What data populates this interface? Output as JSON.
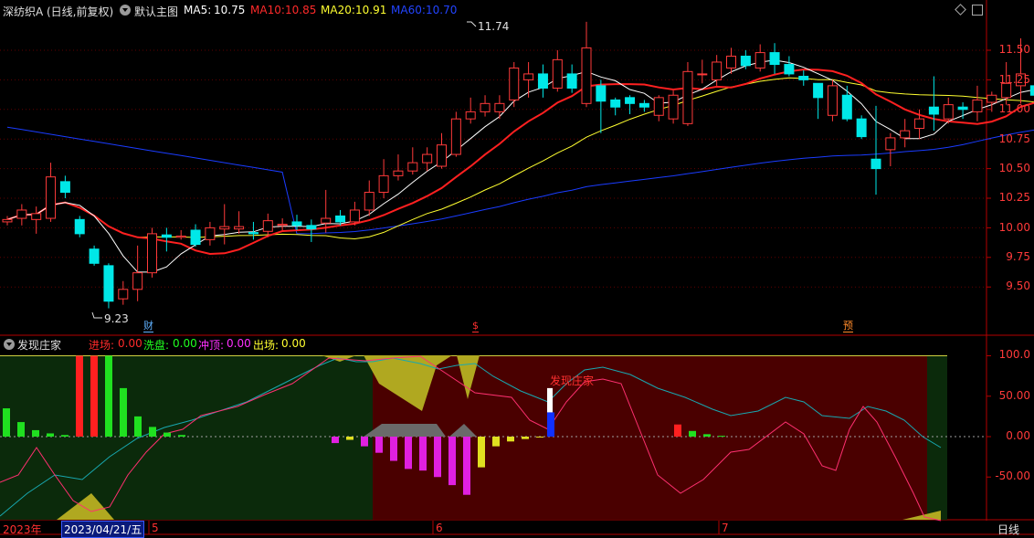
{
  "header": {
    "stock_name": "深纺织A",
    "period": "(日线,前复权)",
    "template": "默认主图",
    "ma5_label": "MA5:",
    "ma5_value": "10.75",
    "ma10_label": "MA10:",
    "ma10_value": "10.85",
    "ma20_label": "MA20:",
    "ma20_value": "10.91",
    "ma60_label": "MA60:",
    "ma60_value": "10.70",
    "colors": {
      "ma5": "#ffffff",
      "ma10": "#ff2020",
      "ma20": "#ffff30",
      "ma60": "#1a3cff"
    }
  },
  "price_axis": [
    "11.50",
    "11.25",
    "11.00",
    "10.75",
    "10.50",
    "10.25",
    "10.00",
    "9.75",
    "9.50"
  ],
  "annotations": {
    "high": "11.74",
    "low": "9.23"
  },
  "event_markers": [
    {
      "label": "财",
      "color": "#5fb0ff"
    },
    {
      "label": "$",
      "color": "#ff3030"
    },
    {
      "label": "预",
      "color": "#ff8a2a"
    }
  ],
  "indicator": {
    "title": "发现庄家",
    "jinchang_label": "进场:",
    "jinchang_value": "0.00",
    "xipan_label": "洗盘:",
    "xipan_value": "0.00",
    "chongding_label": "冲顶:",
    "chongding_value": "0.00",
    "chuchang_label": "出场:",
    "chuchang_value": "0.00",
    "signal_label": "发现庄家",
    "axis": [
      "100.0",
      "50.00",
      "0.00",
      "-50.00"
    ]
  },
  "time_axis": {
    "year_label": "2023年",
    "cursor_date": "2023/04/21/五",
    "months": [
      "5",
      "6",
      "7"
    ]
  },
  "period_button": "日线",
  "chart_data": {
    "type": "candlestick",
    "title": "深纺织A (日线,前复权)",
    "ylim": [
      9.1,
      11.9
    ],
    "price_ticks": [
      9.5,
      9.75,
      10.0,
      10.25,
      10.5,
      10.75,
      11.0,
      11.25,
      11.5
    ],
    "high_marker": 11.74,
    "low_marker": 9.23,
    "moving_averages": {
      "MA5": 10.75,
      "MA10": 10.85,
      "MA20": 10.91,
      "MA60": 10.7
    },
    "candles": [
      [
        10.05,
        10.07,
        10.02,
        10.1
      ],
      [
        10.08,
        10.15,
        10.02,
        10.2
      ],
      [
        10.07,
        10.12,
        9.95,
        10.18
      ],
      [
        10.08,
        10.43,
        10.05,
        10.55
      ],
      [
        10.39,
        10.3,
        10.25,
        10.44
      ],
      [
        10.07,
        9.95,
        9.92,
        10.1
      ],
      [
        9.82,
        9.7,
        9.68,
        9.85
      ],
      [
        9.68,
        9.38,
        9.32,
        9.7
      ],
      [
        9.4,
        9.48,
        9.35,
        9.55
      ],
      [
        9.48,
        9.62,
        9.38,
        9.85
      ],
      [
        9.62,
        9.95,
        9.58,
        10.0
      ],
      [
        9.94,
        9.92,
        9.8,
        10.0
      ],
      [
        9.92,
        9.93,
        9.9,
        9.98
      ],
      [
        9.98,
        9.86,
        9.84,
        10.03
      ],
      [
        9.9,
        10.0,
        9.85,
        10.05
      ],
      [
        9.99,
        10.01,
        9.86,
        10.2
      ],
      [
        9.99,
        10.01,
        9.95,
        10.14
      ],
      [
        9.96,
        9.95,
        9.9,
        10.05
      ],
      [
        9.97,
        10.06,
        9.92,
        10.12
      ],
      [
        10.02,
        10.03,
        9.98,
        10.08
      ],
      [
        10.05,
        10.02,
        9.98,
        10.11
      ],
      [
        10.02,
        9.99,
        9.88,
        10.07
      ],
      [
        10.04,
        10.08,
        9.96,
        10.32
      ],
      [
        10.1,
        10.05,
        10.02,
        10.15
      ],
      [
        10.05,
        10.15,
        10.02,
        10.22
      ],
      [
        10.15,
        10.3,
        10.1,
        10.4
      ],
      [
        10.3,
        10.44,
        10.25,
        10.58
      ],
      [
        10.44,
        10.48,
        10.4,
        10.62
      ],
      [
        10.48,
        10.55,
        10.45,
        10.68
      ],
      [
        10.55,
        10.62,
        10.48,
        10.68
      ],
      [
        10.52,
        10.7,
        10.5,
        10.8
      ],
      [
        10.62,
        10.92,
        10.6,
        10.98
      ],
      [
        10.92,
        10.98,
        10.88,
        11.1
      ],
      [
        10.98,
        11.05,
        10.94,
        11.12
      ],
      [
        10.98,
        11.05,
        10.92,
        11.12
      ],
      [
        11.08,
        11.35,
        11.02,
        11.4
      ],
      [
        11.25,
        11.3,
        11.1,
        11.4
      ],
      [
        11.3,
        11.18,
        11.1,
        11.38
      ],
      [
        11.18,
        11.42,
        11.15,
        11.5
      ],
      [
        11.3,
        11.18,
        11.14,
        11.38
      ],
      [
        11.05,
        11.52,
        11.02,
        11.74
      ],
      [
        11.2,
        11.07,
        10.8,
        11.25
      ],
      [
        11.08,
        11.02,
        10.95,
        11.1
      ],
      [
        11.1,
        11.05,
        10.96,
        11.12
      ],
      [
        11.05,
        11.02,
        10.98,
        11.08
      ],
      [
        10.95,
        11.1,
        10.9,
        11.12
      ],
      [
        10.92,
        11.12,
        10.88,
        11.16
      ],
      [
        10.88,
        11.32,
        10.86,
        11.4
      ],
      [
        11.3,
        11.3,
        11.22,
        11.42
      ],
      [
        11.25,
        11.4,
        11.2,
        11.46
      ],
      [
        11.35,
        11.45,
        11.3,
        11.52
      ],
      [
        11.45,
        11.37,
        11.34,
        11.5
      ],
      [
        11.35,
        11.48,
        11.32,
        11.55
      ],
      [
        11.48,
        11.38,
        11.3,
        11.56
      ],
      [
        11.38,
        11.3,
        11.28,
        11.45
      ],
      [
        11.28,
        11.25,
        11.2,
        11.33
      ],
      [
        11.22,
        11.1,
        10.92,
        11.22
      ],
      [
        10.95,
        11.2,
        10.9,
        11.25
      ],
      [
        11.12,
        10.92,
        10.9,
        11.2
      ],
      [
        10.92,
        10.77,
        10.75,
        10.95
      ],
      [
        10.58,
        10.5,
        10.28,
        11.03
      ],
      [
        10.66,
        10.76,
        10.52,
        10.8
      ],
      [
        10.76,
        10.82,
        10.68,
        10.92
      ],
      [
        10.84,
        10.92,
        10.75,
        11.0
      ],
      [
        11.02,
        10.96,
        10.82,
        11.28
      ],
      [
        10.92,
        11.04,
        10.88,
        11.1
      ],
      [
        11.02,
        11.0,
        10.92,
        11.06
      ],
      [
        10.98,
        11.08,
        10.9,
        11.2
      ],
      [
        11.06,
        11.12,
        10.98,
        11.15
      ],
      [
        11.1,
        11.22,
        11.04,
        11.4
      ],
      [
        11.2,
        11.3,
        11.05,
        11.6
      ],
      [
        11.2,
        11.12,
        10.98,
        11.36
      ],
      [
        11.12,
        11.02,
        10.92,
        11.14
      ],
      [
        11.1,
        10.7,
        10.66,
        11.15
      ],
      [
        10.7,
        11.0,
        10.68,
        11.04
      ],
      [
        10.95,
        10.98,
        10.9,
        11.06
      ],
      [
        11.0,
        11.22,
        10.96,
        11.25
      ],
      [
        11.15,
        11.28,
        11.1,
        11.32
      ],
      [
        11.06,
        11.0,
        10.95,
        11.08
      ],
      [
        10.98,
        10.92,
        10.9,
        11.0
      ],
      [
        10.9,
        10.68,
        10.66,
        10.95
      ],
      [
        10.64,
        10.65,
        10.52,
        10.7
      ],
      [
        10.62,
        10.6,
        10.56,
        10.68
      ]
    ]
  }
}
